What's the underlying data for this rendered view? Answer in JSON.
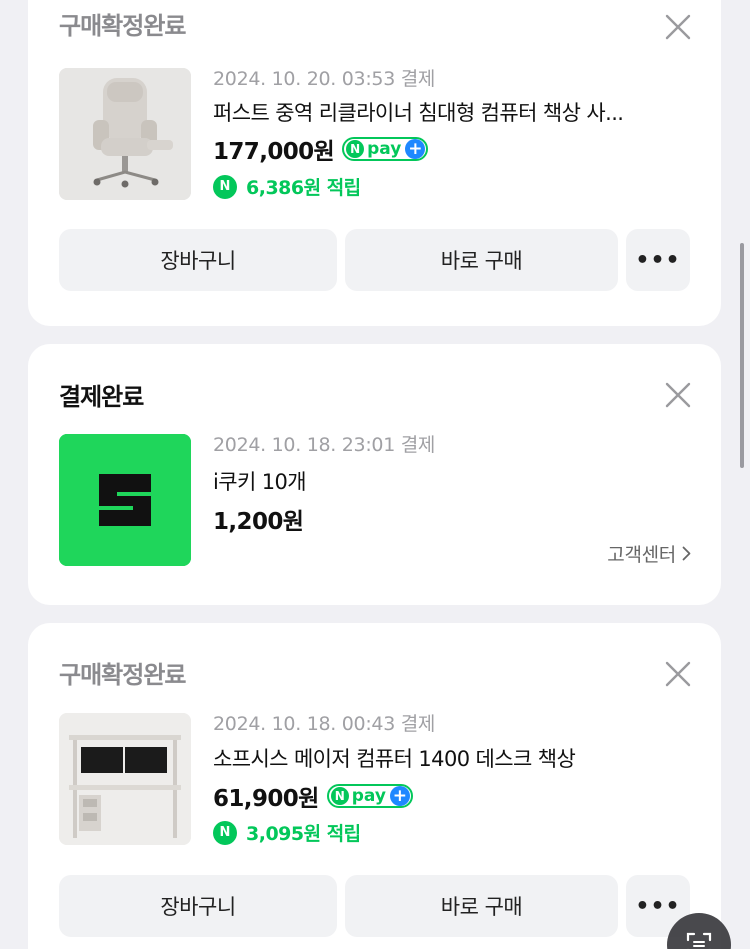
{
  "orders": [
    {
      "status": "구매확정완료",
      "date": "2024. 10. 20. 03:53 결제",
      "title": "퍼스트 중역 리클라이너 침대형 컴퓨터 책상 사...",
      "price": "177,000원",
      "npay_label": "pay",
      "reward": "6,386원 적립",
      "buttons": {
        "cart": "장바구니",
        "buy": "바로 구매",
        "more": "•••"
      },
      "thumb_icon": "office-chair-photo"
    },
    {
      "status": "결제완료",
      "date": "2024. 10. 18. 23:01 결제",
      "title": "i쿠키 10개",
      "price": "1,200원",
      "customer_center": "고객센터",
      "thumb_icon": "series-s-logo",
      "thumb_letter": "S"
    },
    {
      "status": "구매확정완료",
      "date": "2024. 10. 18. 00:43 결제",
      "title": "소프시스 메이저 컴퓨터 1400 데스크 책상",
      "price": "61,900원",
      "npay_label": "pay",
      "reward": "3,095원 적립",
      "buttons": {
        "cart": "장바구니",
        "buy": "바로 구매",
        "more": "•••"
      },
      "thumb_icon": "computer-desk-photo"
    }
  ],
  "colors": {
    "npay_green": "#03c75a",
    "plus_blue": "#1e88ff",
    "card_bg": "#ffffff",
    "page_bg": "#f0f0f4",
    "logo_green": "#1fd65b"
  }
}
